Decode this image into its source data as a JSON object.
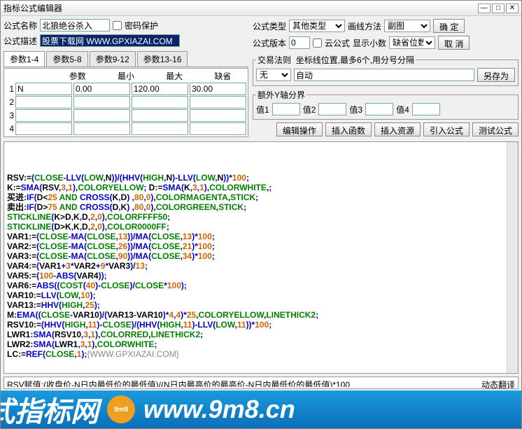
{
  "title": "指标公式编辑器",
  "labels": {
    "name": "公式名称",
    "pwd": "密码保护",
    "type": "公式类型",
    "draw": "画线方法",
    "desc": "公式描述",
    "ver": "公式版本",
    "cloud": "云公式",
    "dec": "显示小数",
    "省位": "缺省位数",
    "ok": "确  定",
    "cancel": "取  消",
    "saveas": "另存为",
    "trade": "交易法则",
    "coord": "坐标线位置,最多6个,用分号分隔",
    "extray": "额外Y轴分界",
    "v1": "值1",
    "v2": "值2",
    "v3": "值3",
    "v4": "值4",
    "editop": "编辑操作",
    "insfn": "插入函数",
    "insres": "插入资源",
    "import": "引入公式",
    "test": "测试公式",
    "参数": "参数",
    "最小": "最小",
    "最大": "最大",
    "缺省": "缺省",
    "tab1": "参数1-4",
    "tab2": "参数5-8",
    "tab3": "参数9-12",
    "tab4": "参数13-16",
    "dynxlate": "动态翻译"
  },
  "values": {
    "name": "北狼绝谷杀入",
    "desc": "股票下载网 WWW.GPXIAZAI.COM",
    "type": "其他类型",
    "draw": "副图",
    "ver": "0",
    "trade_sel": "无",
    "trade_auto": "自动",
    "params": [
      {
        "n": "N",
        "min": "0.00",
        "max": "120.00",
        "def": "30.00"
      },
      {
        "n": "",
        "min": "",
        "max": "",
        "def": ""
      },
      {
        "n": "",
        "min": "",
        "max": "",
        "def": ""
      },
      {
        "n": "",
        "min": "",
        "max": "",
        "def": ""
      }
    ]
  },
  "hint": "RSV赋值:(收盘价-N日内最低价的最低值)/(N日内最高价的最高价-N日内最低价的最低值)*100",
  "footer": {
    "left": "式指标网",
    "url": "www.9m8.cn",
    "logo": "9m8"
  },
  "code_lines": [
    [
      [
        "id",
        "RSV:="
      ],
      [
        "f",
        "("
      ],
      [
        "k",
        "CLOSE"
      ],
      [
        "f",
        "-LLV("
      ],
      [
        "k",
        "LOW"
      ],
      [
        "f",
        ","
      ],
      [
        "id",
        "N"
      ],
      [
        "f",
        "))/(HHV("
      ],
      [
        "k",
        "HIGH"
      ],
      [
        "f",
        ","
      ],
      [
        "id",
        "N"
      ],
      [
        "f",
        ")-LLV("
      ],
      [
        "k",
        "LOW"
      ],
      [
        "f",
        ","
      ],
      [
        "id",
        "N"
      ],
      [
        "f",
        "))*"
      ],
      [
        "n",
        "100"
      ],
      [
        "f",
        ";"
      ]
    ],
    [
      [
        "id",
        "K:="
      ],
      [
        "f",
        "SMA("
      ],
      [
        "id",
        "RSV"
      ],
      [
        "f",
        ","
      ],
      [
        "n",
        "3"
      ],
      [
        "f",
        ","
      ],
      [
        "n",
        "1"
      ],
      [
        "f",
        ")"
      ],
      [
        "id",
        ","
      ],
      [
        "k",
        "COLORYELLOW"
      ],
      [
        "f",
        "; "
      ],
      [
        "id",
        "D:="
      ],
      [
        "f",
        "SMA("
      ],
      [
        "id",
        "K"
      ],
      [
        "f",
        ","
      ],
      [
        "n",
        "3"
      ],
      [
        "f",
        ","
      ],
      [
        "n",
        "1"
      ],
      [
        "f",
        ")"
      ],
      [
        "id",
        ","
      ],
      [
        "k",
        "COLORWHITE"
      ],
      [
        "id",
        ","
      ],
      [
        "f",
        ";"
      ]
    ],
    [
      [
        "id",
        "买进:"
      ],
      [
        "f",
        "IF("
      ],
      [
        "id",
        "D<"
      ],
      [
        "n",
        "25"
      ],
      [
        "k",
        " AND "
      ],
      [
        "f",
        "CROSS("
      ],
      [
        "id",
        "K"
      ],
      [
        "f",
        ","
      ],
      [
        "id",
        "D"
      ],
      [
        "f",
        ") ,"
      ],
      [
        "n",
        "80"
      ],
      [
        "f",
        ","
      ],
      [
        "n",
        "0"
      ],
      [
        "f",
        ")"
      ],
      [
        "id",
        ","
      ],
      [
        "k",
        "COLORMAGENTA"
      ],
      [
        "id",
        ","
      ],
      [
        "k",
        "STICK"
      ],
      [
        "f",
        ";"
      ]
    ],
    [
      [
        "id",
        "卖出:"
      ],
      [
        "f",
        "IF("
      ],
      [
        "id",
        "D>"
      ],
      [
        "n",
        "75"
      ],
      [
        "k",
        " AND "
      ],
      [
        "f",
        "CROSS("
      ],
      [
        "id",
        "D"
      ],
      [
        "f",
        ","
      ],
      [
        "id",
        "K"
      ],
      [
        "f",
        ") ,"
      ],
      [
        "n",
        "80"
      ],
      [
        "f",
        ","
      ],
      [
        "n",
        "0"
      ],
      [
        "f",
        ")"
      ],
      [
        "id",
        ","
      ],
      [
        "k",
        "COLORGREEN"
      ],
      [
        "id",
        ","
      ],
      [
        "k",
        "STICK"
      ],
      [
        "f",
        ";"
      ]
    ],
    [
      [
        "k",
        "STICKLINE"
      ],
      [
        "f",
        "("
      ],
      [
        "id",
        "K>D"
      ],
      [
        "f",
        ","
      ],
      [
        "id",
        "K"
      ],
      [
        "f",
        ","
      ],
      [
        "id",
        "D"
      ],
      [
        "f",
        ","
      ],
      [
        "n",
        "2"
      ],
      [
        "f",
        ","
      ],
      [
        "n",
        "0"
      ],
      [
        "f",
        ")"
      ],
      [
        "id",
        ","
      ],
      [
        "k",
        "COLORFFFF50"
      ],
      [
        "f",
        ";"
      ]
    ],
    [
      [
        "k",
        "STICKLINE"
      ],
      [
        "f",
        "("
      ],
      [
        "id",
        "D>K"
      ],
      [
        "f",
        ","
      ],
      [
        "id",
        "K"
      ],
      [
        "f",
        ","
      ],
      [
        "id",
        "D"
      ],
      [
        "f",
        ","
      ],
      [
        "n",
        "2"
      ],
      [
        "f",
        ","
      ],
      [
        "n",
        "0"
      ],
      [
        "f",
        ")"
      ],
      [
        "id",
        ","
      ],
      [
        "k",
        "COLOR0000FF"
      ],
      [
        "f",
        ";"
      ]
    ],
    [
      [
        "id",
        "VAR1:="
      ],
      [
        "f",
        "("
      ],
      [
        "k",
        "CLOSE"
      ],
      [
        "f",
        "-MA("
      ],
      [
        "k",
        "CLOSE"
      ],
      [
        "f",
        ","
      ],
      [
        "n",
        "13"
      ],
      [
        "f",
        "))/MA("
      ],
      [
        "k",
        "CLOSE"
      ],
      [
        "f",
        ","
      ],
      [
        "n",
        "13"
      ],
      [
        "f",
        ")*"
      ],
      [
        "n",
        "100"
      ],
      [
        "f",
        ";"
      ]
    ],
    [
      [
        "id",
        "VAR2:="
      ],
      [
        "f",
        "("
      ],
      [
        "k",
        "CLOSE"
      ],
      [
        "f",
        "-MA("
      ],
      [
        "k",
        "CLOSE"
      ],
      [
        "f",
        ","
      ],
      [
        "n",
        "26"
      ],
      [
        "f",
        "))/MA("
      ],
      [
        "k",
        "CLOSE"
      ],
      [
        "f",
        ","
      ],
      [
        "n",
        "21"
      ],
      [
        "f",
        ")*"
      ],
      [
        "n",
        "100"
      ],
      [
        "f",
        ";"
      ]
    ],
    [
      [
        "id",
        "VAR3:="
      ],
      [
        "f",
        "("
      ],
      [
        "k",
        "CLOSE"
      ],
      [
        "f",
        "-MA("
      ],
      [
        "k",
        "CLOSE"
      ],
      [
        "f",
        ","
      ],
      [
        "n",
        "90"
      ],
      [
        "f",
        "))/MA("
      ],
      [
        "k",
        "CLOSE"
      ],
      [
        "f",
        ","
      ],
      [
        "n",
        "34"
      ],
      [
        "f",
        ")*"
      ],
      [
        "n",
        "100"
      ],
      [
        "f",
        ";"
      ]
    ],
    [
      [
        "id",
        "VAR4:="
      ],
      [
        "f",
        "("
      ],
      [
        "id",
        "VAR1"
      ],
      [
        "f",
        "+"
      ],
      [
        "n",
        "3"
      ],
      [
        "f",
        "*"
      ],
      [
        "id",
        "VAR2"
      ],
      [
        "f",
        "+"
      ],
      [
        "n",
        "9"
      ],
      [
        "f",
        "*"
      ],
      [
        "id",
        "VAR3"
      ],
      [
        "f",
        ")/"
      ],
      [
        "n",
        "13"
      ],
      [
        "f",
        ";"
      ]
    ],
    [
      [
        "id",
        "VAR5:="
      ],
      [
        "f",
        "("
      ],
      [
        "n",
        "100"
      ],
      [
        "f",
        "-ABS("
      ],
      [
        "id",
        "VAR4"
      ],
      [
        "f",
        "));"
      ]
    ],
    [
      [
        "id",
        "VAR6:="
      ],
      [
        "f",
        "ABS(("
      ],
      [
        "k",
        "COST"
      ],
      [
        "f",
        "("
      ],
      [
        "n",
        "40"
      ],
      [
        "f",
        ")-"
      ],
      [
        "k",
        "CLOSE"
      ],
      [
        "f",
        ")/"
      ],
      [
        "k",
        "CLOSE"
      ],
      [
        "f",
        "*"
      ],
      [
        "n",
        "100"
      ],
      [
        "f",
        ");"
      ]
    ],
    [
      [
        "id",
        "VAR10:="
      ],
      [
        "f",
        "LLV("
      ],
      [
        "k",
        "LOW"
      ],
      [
        "f",
        ","
      ],
      [
        "n",
        "10"
      ],
      [
        "f",
        ");"
      ]
    ],
    [
      [
        "id",
        "VAR13:="
      ],
      [
        "f",
        "HHV("
      ],
      [
        "k",
        "HIGH"
      ],
      [
        "f",
        ","
      ],
      [
        "n",
        "25"
      ],
      [
        "f",
        ");"
      ]
    ],
    [
      [
        "id",
        "M:"
      ],
      [
        "f",
        "EMA(("
      ],
      [
        "k",
        "CLOSE"
      ],
      [
        "f",
        "-"
      ],
      [
        "id",
        "VAR10"
      ],
      [
        "f",
        ")/("
      ],
      [
        "id",
        "VAR13"
      ],
      [
        "f",
        "-"
      ],
      [
        "id",
        "VAR10"
      ],
      [
        "f",
        ")*"
      ],
      [
        "n",
        "4"
      ],
      [
        "f",
        ","
      ],
      [
        "n",
        "4"
      ],
      [
        "f",
        ")*"
      ],
      [
        "n",
        "25"
      ],
      [
        "id",
        ","
      ],
      [
        "k",
        "COLORYELLOW"
      ],
      [
        "id",
        ","
      ],
      [
        "k",
        "LINETHICK2"
      ],
      [
        "f",
        ";"
      ]
    ],
    [
      [
        "id",
        "RSV10:="
      ],
      [
        "f",
        "(HHV("
      ],
      [
        "k",
        "HIGH"
      ],
      [
        "f",
        ","
      ],
      [
        "n",
        "11"
      ],
      [
        "f",
        ")-"
      ],
      [
        "k",
        "CLOSE"
      ],
      [
        "f",
        ")/(HHV("
      ],
      [
        "k",
        "HIGH"
      ],
      [
        "f",
        ","
      ],
      [
        "n",
        "11"
      ],
      [
        "f",
        ")-LLV("
      ],
      [
        "k",
        "LOW"
      ],
      [
        "f",
        ","
      ],
      [
        "n",
        "11"
      ],
      [
        "f",
        "))*"
      ],
      [
        "n",
        "100"
      ],
      [
        "f",
        ";"
      ]
    ],
    [
      [
        "id",
        "LWR1:"
      ],
      [
        "f",
        "SMA("
      ],
      [
        "id",
        "RSV10"
      ],
      [
        "f",
        ","
      ],
      [
        "n",
        "3"
      ],
      [
        "f",
        ","
      ],
      [
        "n",
        "1"
      ],
      [
        "f",
        ")"
      ],
      [
        "id",
        ","
      ],
      [
        "k",
        "COLORRED"
      ],
      [
        "id",
        ","
      ],
      [
        "k",
        "LINETHICK2"
      ],
      [
        "f",
        ";"
      ]
    ],
    [
      [
        "id",
        "LWR2:"
      ],
      [
        "f",
        "SMA("
      ],
      [
        "id",
        "LWR1"
      ],
      [
        "f",
        ","
      ],
      [
        "n",
        "3"
      ],
      [
        "f",
        ","
      ],
      [
        "n",
        "1"
      ],
      [
        "f",
        ")"
      ],
      [
        "id",
        ","
      ],
      [
        "k",
        "COLORWHITE"
      ],
      [
        "f",
        ";"
      ]
    ],
    [
      [
        "id",
        "LC:="
      ],
      [
        "f",
        "REF("
      ],
      [
        "k",
        "CLOSE"
      ],
      [
        "f",
        ","
      ],
      [
        "n",
        "1"
      ],
      [
        "f",
        ");"
      ],
      [
        "c",
        "{WWW.GPXIAZAI.COM}"
      ]
    ]
  ]
}
